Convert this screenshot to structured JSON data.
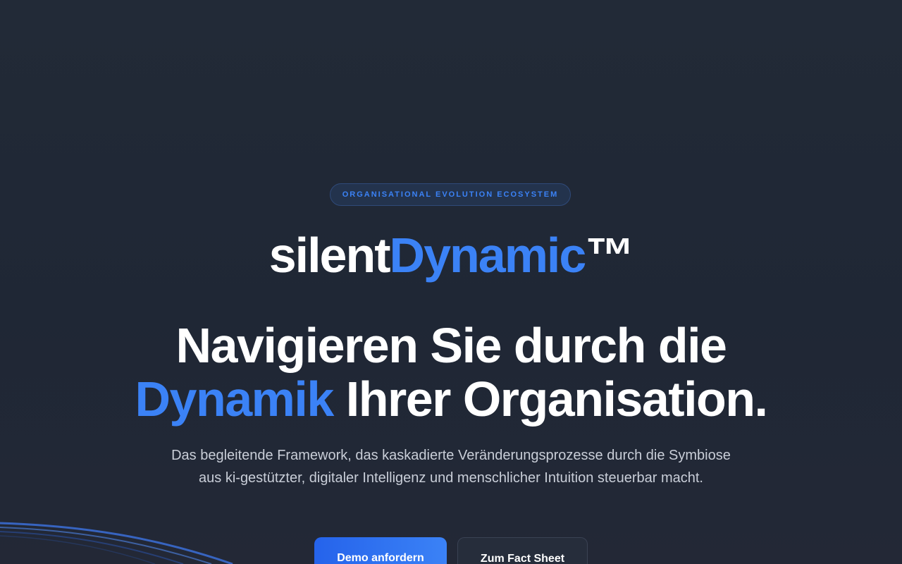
{
  "hero": {
    "badge": "ORGANISATIONAL EVOLUTION ECOSYSTEM",
    "brand": {
      "part1": "silent",
      "part2": "Dynamic",
      "trademark": "™"
    },
    "headline": {
      "line1": "Navigieren Sie durch die",
      "highlight": "Dynamik",
      "line2_rest": " Ihrer Organisation."
    },
    "subtitle": {
      "line1": "Das begleitende Framework, das kaskadierte Veränderungsprozesse durch die Symbiose",
      "line2": "aus ki-gestützter, digitaler Intelligenz und menschlicher Intuition steuerbar macht."
    },
    "buttons": {
      "primary": "Demo anfordern",
      "secondary": "Zum Fact Sheet"
    }
  },
  "colors": {
    "accent": "#3b82f6",
    "background": "#222a37",
    "text": "#ffffff",
    "muted_text": "#c9ced8"
  }
}
